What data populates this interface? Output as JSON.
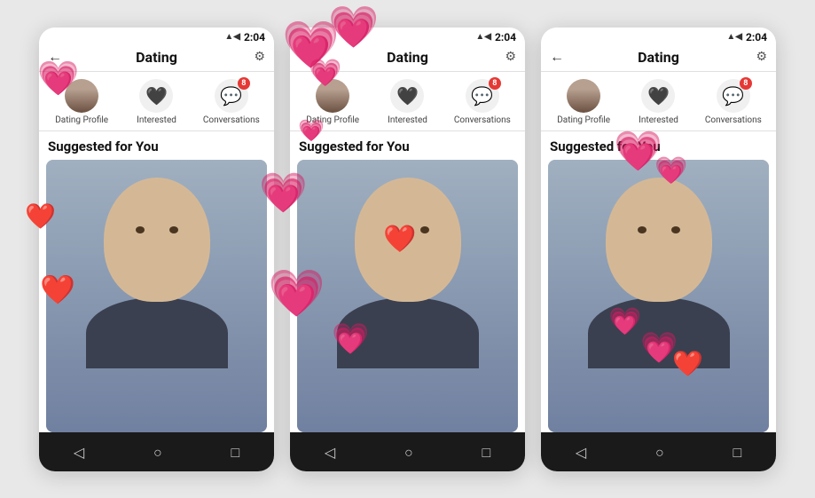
{
  "app": {
    "title": "Dating",
    "back_arrow": "←",
    "time": "2:04",
    "status_icons": "▲◀ 📶 🔋"
  },
  "nav_tabs": [
    {
      "label": "Dating Profile",
      "icon": "avatar",
      "badge": null
    },
    {
      "label": "Interested",
      "icon": "heart",
      "badge": null
    },
    {
      "label": "Conversations",
      "icon": "chat",
      "badge": "8"
    }
  ],
  "section_title": "Suggested for You",
  "bottom_nav": {
    "back": "◁",
    "home": "○",
    "square": "□"
  },
  "hearts": {
    "pink_emoji": "💗",
    "red_emoji": "❤️"
  }
}
